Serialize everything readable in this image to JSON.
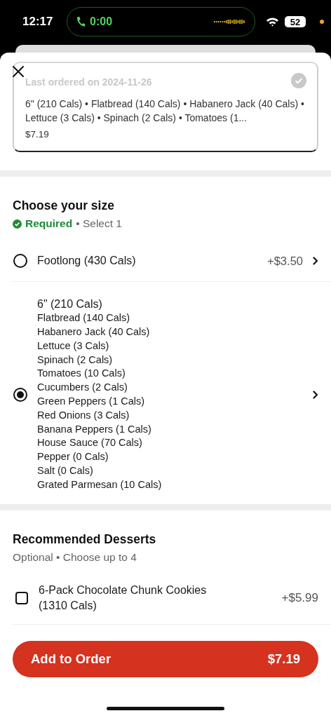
{
  "status_bar": {
    "time": "12:17",
    "call_timer": "0:00",
    "battery": "52"
  },
  "last_order": {
    "title": "Last ordered on 2024-11-26",
    "checked": true,
    "summary": "6\" (210 Cals) • Flatbread (140 Cals) • Habanero Jack (40 Cals) • Lettuce (3 Cals) • Spinach (2 Cals) • Tomatoes (1...",
    "price": "$7.19"
  },
  "size_section": {
    "title": "Choose your size",
    "requirement": "Required",
    "rule": "• Select 1",
    "options": [
      {
        "label": "Footlong (430 Cals)",
        "price": "+$3.50",
        "selected": false
      },
      {
        "label": "6\" (210 Cals)",
        "selected": true,
        "details": [
          "Flatbread (140 Cals)",
          "Habanero Jack (40 Cals)",
          "Lettuce (3 Cals)",
          "Spinach (2 Cals)",
          "Tomatoes (10 Cals)",
          "Cucumbers (2 Cals)",
          "Green Peppers (1 Cals)",
          "Red Onions (3 Cals)",
          "Banana Peppers (1 Cals)",
          "House Sauce (70 Cals)",
          "Pepper (0 Cals)",
          "Salt (0 Cals)",
          "Grated Parmesan (10 Cals)"
        ]
      }
    ]
  },
  "desserts_section": {
    "title": "Recommended Desserts",
    "rule": "Optional • Choose up to 4",
    "items": [
      {
        "label": "6-Pack Chocolate Chunk Cookies (1310 Cals)",
        "price": "+$5.99",
        "checked": false
      }
    ]
  },
  "footer": {
    "button": "Add to Order",
    "total": "$7.19"
  }
}
